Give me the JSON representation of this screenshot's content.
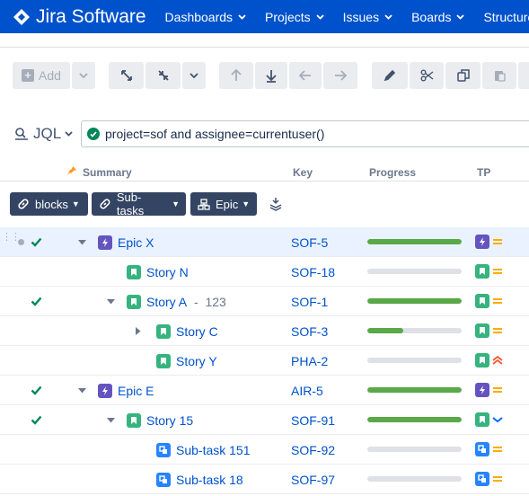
{
  "nav": {
    "product": "Jira Software",
    "items": [
      "Dashboards",
      "Projects",
      "Issues",
      "Boards",
      "Structure"
    ]
  },
  "toolbar": {
    "add_label": "Add"
  },
  "jql": {
    "label": "JQL",
    "query": "project=sof and assignee=currentuser()"
  },
  "columns": {
    "summary": "Summary",
    "key": "Key",
    "progress": "Progress",
    "tp": "TP"
  },
  "groups": [
    {
      "label": "blocks",
      "icon": "link-icon"
    },
    {
      "label": "Sub-tasks",
      "icon": "link-icon"
    },
    {
      "label": "Epic",
      "icon": "hierarchy-icon"
    }
  ],
  "rows": [
    {
      "summary": "Epic X",
      "count": "",
      "key": "SOF-5",
      "type": "epic",
      "progress": 1.0,
      "resolved": true,
      "priority": "medium",
      "expanded": true
    },
    {
      "summary": "Story N",
      "count": "",
      "key": "SOF-18",
      "type": "story",
      "progress": 0,
      "resolved": false,
      "priority": "medium"
    },
    {
      "summary": "Story A",
      "count": "123",
      "key": "SOF-1",
      "type": "story",
      "progress": 1.0,
      "resolved": true,
      "priority": "medium",
      "expanded": true
    },
    {
      "summary": "Story C",
      "count": "",
      "key": "SOF-3",
      "type": "story",
      "progress": 0.38,
      "resolved": false,
      "priority": "medium",
      "expanded": false
    },
    {
      "summary": "Story Y",
      "count": "",
      "key": "PHA-2",
      "type": "story",
      "progress": 0,
      "resolved": false,
      "priority": "highest"
    },
    {
      "summary": "Epic E",
      "count": "",
      "key": "AIR-5",
      "type": "epic",
      "progress": 1.0,
      "resolved": true,
      "priority": "medium",
      "expanded": true
    },
    {
      "summary": "Story 15",
      "count": "",
      "key": "SOF-91",
      "type": "story",
      "progress": 1.0,
      "resolved": true,
      "priority": "low",
      "expanded": true
    },
    {
      "summary": "Sub-task 151",
      "count": "",
      "key": "SOF-92",
      "type": "subtask",
      "progress": 0,
      "resolved": false,
      "priority": "medium"
    },
    {
      "summary": "Sub-task 18",
      "count": "",
      "key": "SOF-97",
      "type": "subtask",
      "progress": 0,
      "resolved": false,
      "priority": "medium"
    }
  ],
  "colors": {
    "nav": "#0052cc",
    "epic": "#6554c0",
    "story": "#36b37e",
    "subtask": "#2684ff",
    "progress": "#5aa847",
    "medium": "#ffab00",
    "highest": "#ff5630",
    "low": "#0065ff"
  }
}
